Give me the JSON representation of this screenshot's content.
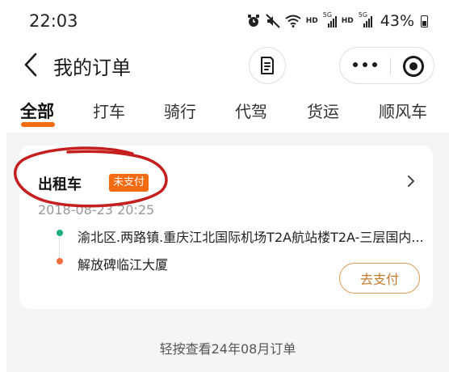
{
  "status_bar": {
    "time": "22:03",
    "hd1": "HD",
    "hd2": "HD",
    "net1": "5G",
    "net2": "5G",
    "battery": "43%"
  },
  "nav": {
    "title": "我的订单"
  },
  "tabs": [
    {
      "label": "全部",
      "active": true
    },
    {
      "label": "打车",
      "active": false
    },
    {
      "label": "骑行",
      "active": false
    },
    {
      "label": "代驾",
      "active": false
    },
    {
      "label": "货运",
      "active": false
    },
    {
      "label": "顺风车",
      "active": false
    }
  ],
  "order": {
    "type": "出租车",
    "status": "未支付",
    "time": "2018-08-23 20:25",
    "from": "渝北区.两路镇.重庆江北国际机场T2A航站楼T2A-三层国内...",
    "to": "解放碑临江大厦",
    "action": "去支付"
  },
  "footer": {
    "hint": "轻按查看24年08月订单"
  },
  "colors": {
    "accent": "#f46a10",
    "start_dot": "#1db17e",
    "end_dot": "#f26d3d",
    "pay_border": "#d99a51",
    "annotation": "#c41e1e",
    "list_bg": "#f3f5f7"
  }
}
